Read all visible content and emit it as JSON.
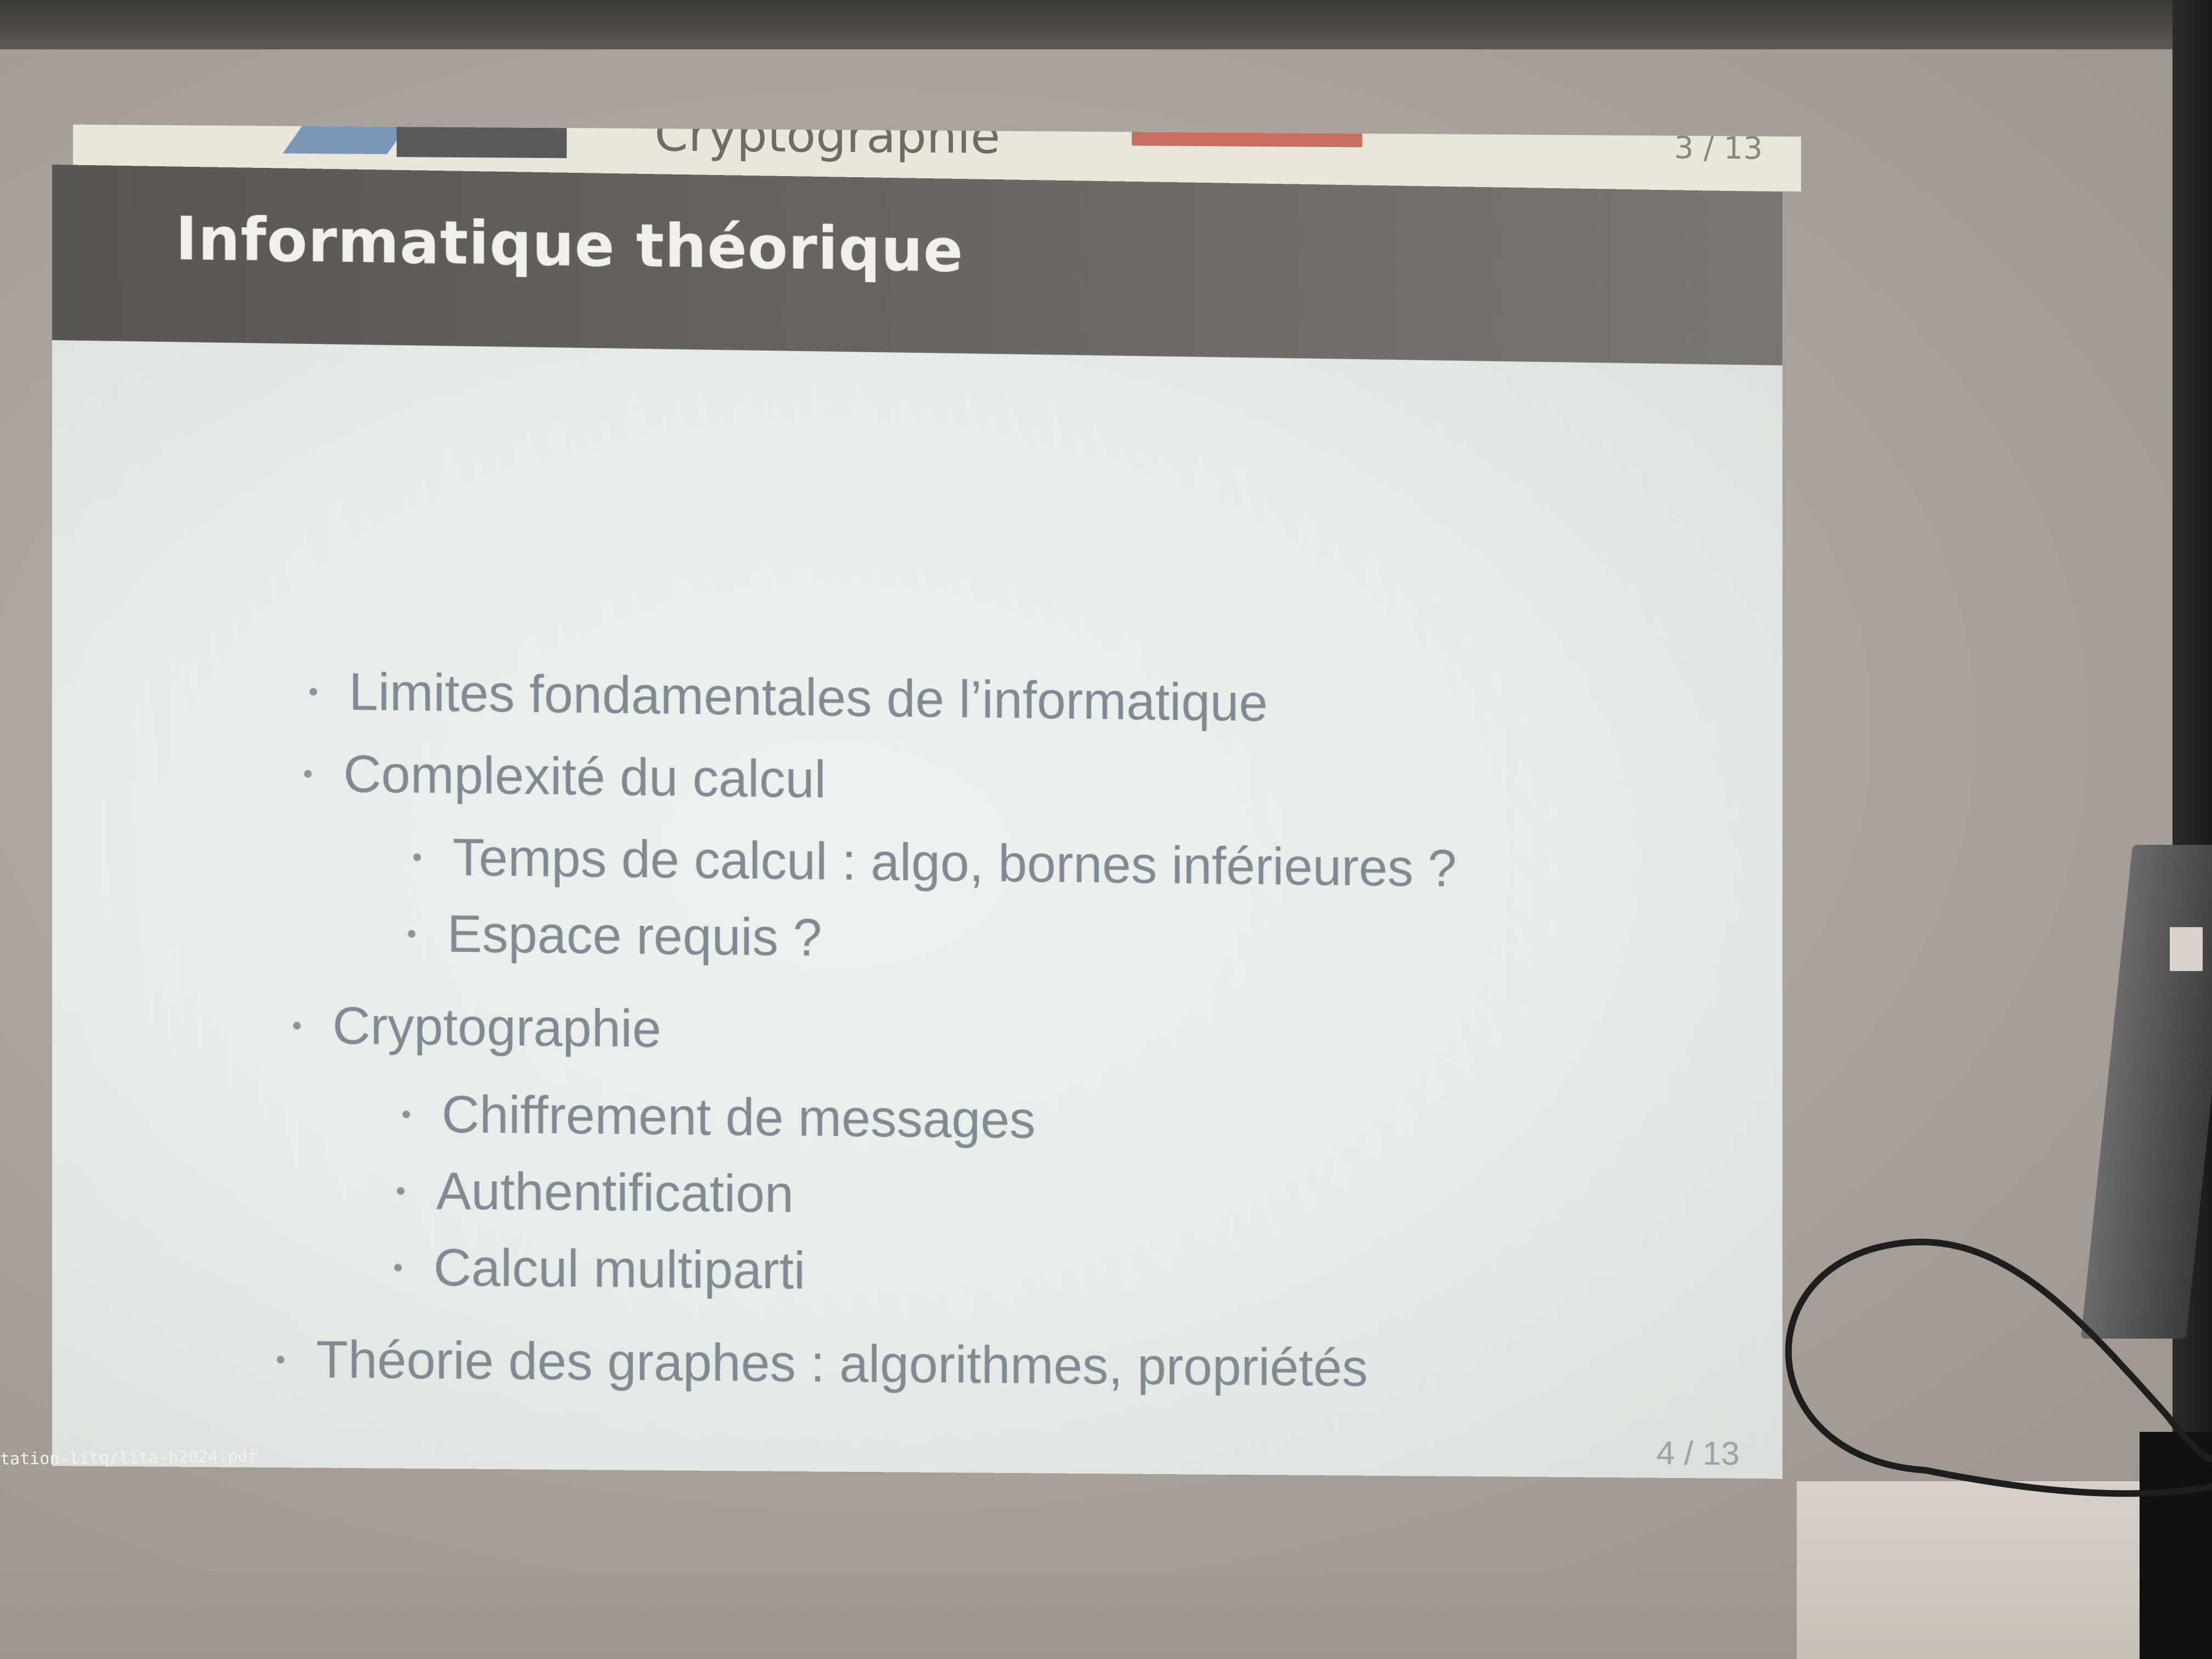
{
  "slide": {
    "previous_title": "Cryptographie",
    "previous_page": "3 / 13",
    "title": "Informatique théorique",
    "page": "4 / 13",
    "items": [
      {
        "text": "Limites fondamentales de l’informatique",
        "level": 1
      },
      {
        "text": "Complexité du calcul",
        "level": 1
      },
      {
        "text": "Temps de calcul : algo, bornes inférieures ?",
        "level": 2
      },
      {
        "text": "Espace requis ?",
        "level": 2
      },
      {
        "text": "Cryptographie",
        "level": 1
      },
      {
        "text": "Chiffrement de messages",
        "level": 2
      },
      {
        "text": "Authentification",
        "level": 2
      },
      {
        "text": "Calcul multiparti",
        "level": 2
      },
      {
        "text": "Théorie des graphes : algorithmes, propriétés",
        "level": 1
      }
    ]
  },
  "viewer": {
    "file_path": "tation-litq/lita-h2024.pdf"
  }
}
